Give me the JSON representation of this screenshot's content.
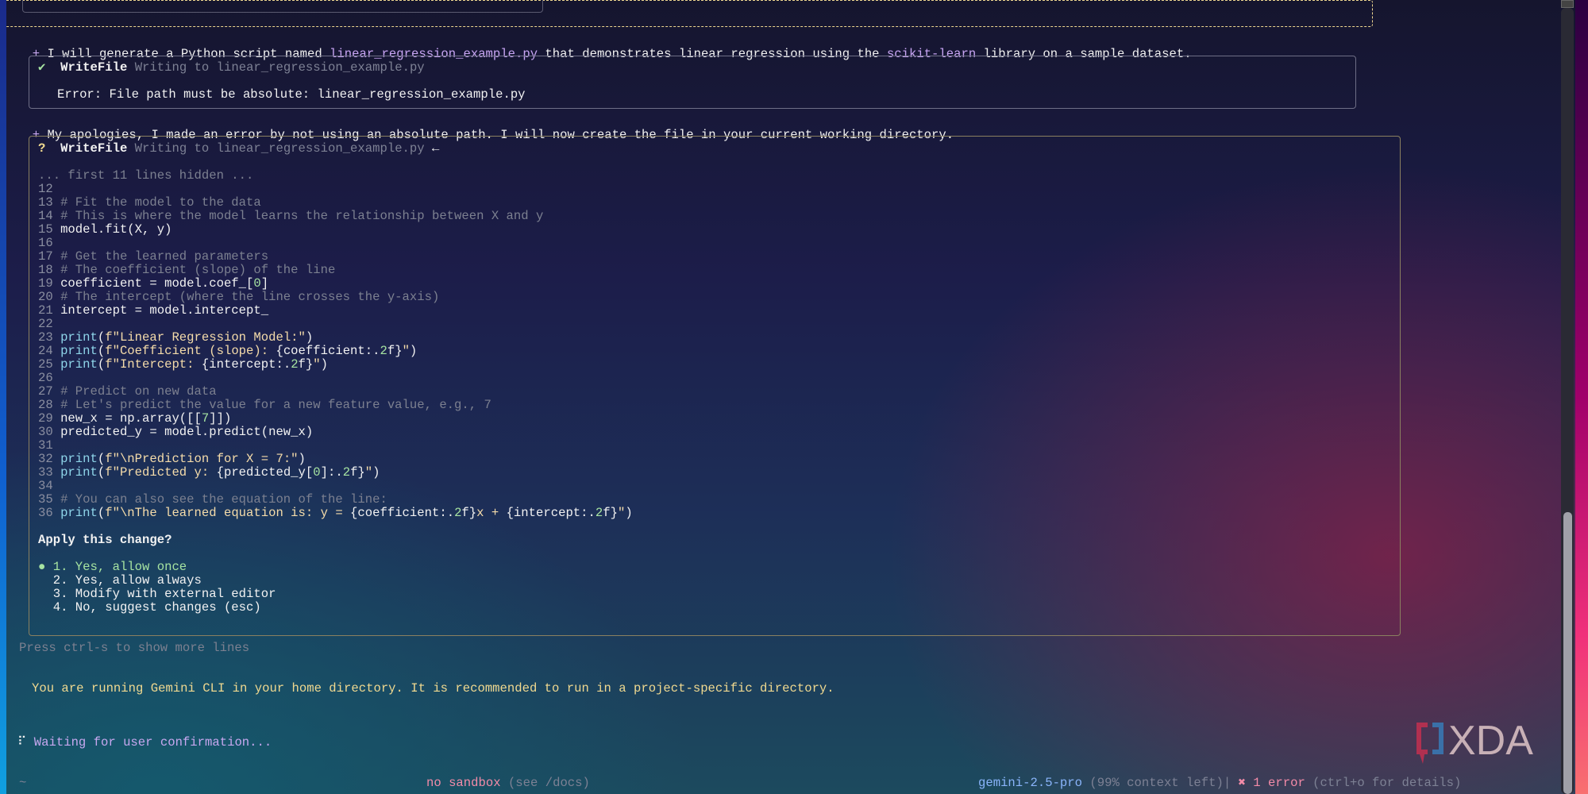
{
  "messages": [
    {
      "bullet": "+",
      "parts": [
        {
          "t": "I will generate a Python script named ",
          "c": "plain"
        },
        {
          "t": "linear_regression_example.py",
          "c": "purple"
        },
        {
          "t": " that demonstrates linear regression using the ",
          "c": "plain"
        },
        {
          "t": "scikit-learn",
          "c": "purple"
        },
        {
          "t": " library on a sample dataset.",
          "c": "plain"
        }
      ]
    },
    {
      "bullet": "+",
      "parts": [
        {
          "t": "My apologies, I made an error by not using an absolute path. I will now create the file in your current working directory.",
          "c": "plain"
        }
      ]
    }
  ],
  "tool1": {
    "status_icon": "✔",
    "name": "WriteFile",
    "desc": "Writing to linear_regression_example.py",
    "error": "Error: File path must be absolute: linear_regression_example.py"
  },
  "tool2": {
    "status_icon": "?",
    "name": "WriteFile",
    "desc": "Writing to linear_regression_example.py",
    "arrow": "←",
    "hidden_note": "... first 11 lines hidden ...",
    "code": [
      {
        "n": "12",
        "s": []
      },
      {
        "n": "13",
        "s": [
          {
            "t": "# Fit the model to the data",
            "c": "comment"
          }
        ]
      },
      {
        "n": "14",
        "s": [
          {
            "t": "# This is where the model learns the relationship between X and y",
            "c": "comment"
          }
        ]
      },
      {
        "n": "15",
        "s": [
          {
            "t": "model.fit(X, y)",
            "c": "plain"
          }
        ]
      },
      {
        "n": "16",
        "s": []
      },
      {
        "n": "17",
        "s": [
          {
            "t": "# Get the learned parameters",
            "c": "comment"
          }
        ]
      },
      {
        "n": "18",
        "s": [
          {
            "t": "# The coefficient (slope) of the line",
            "c": "comment"
          }
        ]
      },
      {
        "n": "19",
        "s": [
          {
            "t": "coefficient = model.coef_[",
            "c": "plain"
          },
          {
            "t": "0",
            "c": "num"
          },
          {
            "t": "]",
            "c": "plain"
          }
        ]
      },
      {
        "n": "20",
        "s": [
          {
            "t": "# The intercept (where the line crosses the y-axis)",
            "c": "comment"
          }
        ]
      },
      {
        "n": "21",
        "s": [
          {
            "t": "intercept = model.intercept_",
            "c": "plain"
          }
        ]
      },
      {
        "n": "22",
        "s": []
      },
      {
        "n": "23",
        "s": [
          {
            "t": "print",
            "c": "fn"
          },
          {
            "t": "(",
            "c": "plain"
          },
          {
            "t": "f\"Linear Regression Model:\"",
            "c": "str"
          },
          {
            "t": ")",
            "c": "plain"
          }
        ]
      },
      {
        "n": "24",
        "s": [
          {
            "t": "print",
            "c": "fn"
          },
          {
            "t": "(",
            "c": "plain"
          },
          {
            "t": "f\"Coefficient (slope): ",
            "c": "str"
          },
          {
            "t": "{coefficient:.",
            "c": "plain"
          },
          {
            "t": "2",
            "c": "num"
          },
          {
            "t": "f}",
            "c": "plain"
          },
          {
            "t": "\"",
            "c": "str"
          },
          {
            "t": ")",
            "c": "plain"
          }
        ]
      },
      {
        "n": "25",
        "s": [
          {
            "t": "print",
            "c": "fn"
          },
          {
            "t": "(",
            "c": "plain"
          },
          {
            "t": "f\"Intercept: ",
            "c": "str"
          },
          {
            "t": "{intercept:.",
            "c": "plain"
          },
          {
            "t": "2",
            "c": "num"
          },
          {
            "t": "f}",
            "c": "plain"
          },
          {
            "t": "\"",
            "c": "str"
          },
          {
            "t": ")",
            "c": "plain"
          }
        ]
      },
      {
        "n": "26",
        "s": []
      },
      {
        "n": "27",
        "s": [
          {
            "t": "# Predict on new data",
            "c": "comment"
          }
        ]
      },
      {
        "n": "28",
        "s": [
          {
            "t": "# Let's predict the value for a new feature value, e.g., 7",
            "c": "comment"
          }
        ]
      },
      {
        "n": "29",
        "s": [
          {
            "t": "new_x = np.array([[",
            "c": "plain"
          },
          {
            "t": "7",
            "c": "num"
          },
          {
            "t": "]])",
            "c": "plain"
          }
        ]
      },
      {
        "n": "30",
        "s": [
          {
            "t": "predicted_y = model.predict(new_x)",
            "c": "plain"
          }
        ]
      },
      {
        "n": "31",
        "s": []
      },
      {
        "n": "32",
        "s": [
          {
            "t": "print",
            "c": "fn"
          },
          {
            "t": "(",
            "c": "plain"
          },
          {
            "t": "f\"\\nPrediction for X = 7:\"",
            "c": "str"
          },
          {
            "t": ")",
            "c": "plain"
          }
        ]
      },
      {
        "n": "33",
        "s": [
          {
            "t": "print",
            "c": "fn"
          },
          {
            "t": "(",
            "c": "plain"
          },
          {
            "t": "f\"Predicted y: ",
            "c": "str"
          },
          {
            "t": "{predicted_y[",
            "c": "plain"
          },
          {
            "t": "0",
            "c": "num"
          },
          {
            "t": "]:.",
            "c": "plain"
          },
          {
            "t": "2",
            "c": "num"
          },
          {
            "t": "f}",
            "c": "plain"
          },
          {
            "t": "\"",
            "c": "str"
          },
          {
            "t": ")",
            "c": "plain"
          }
        ]
      },
      {
        "n": "34",
        "s": []
      },
      {
        "n": "35",
        "s": [
          {
            "t": "# You can also see the equation of the line:",
            "c": "comment"
          }
        ]
      },
      {
        "n": "36",
        "s": [
          {
            "t": "print",
            "c": "fn"
          },
          {
            "t": "(",
            "c": "plain"
          },
          {
            "t": "f\"\\nThe learned equation is: y = ",
            "c": "str"
          },
          {
            "t": "{coefficient:.",
            "c": "plain"
          },
          {
            "t": "2",
            "c": "num"
          },
          {
            "t": "f}",
            "c": "plain"
          },
          {
            "t": "x + ",
            "c": "str"
          },
          {
            "t": "{intercept:.",
            "c": "plain"
          },
          {
            "t": "2",
            "c": "num"
          },
          {
            "t": "f}",
            "c": "plain"
          },
          {
            "t": "\"",
            "c": "str"
          },
          {
            "t": ")",
            "c": "plain"
          }
        ]
      }
    ],
    "question": "Apply this change?",
    "selected_marker": "●",
    "options": [
      "1. Yes, allow once",
      "2. Yes, allow always",
      "3. Modify with external editor",
      "4. No, suggest changes (esc)"
    ]
  },
  "more_lines_hint": "Press ctrl-s to show more lines",
  "warning": "You are running Gemini CLI in your home directory. It is recommended to run in a project-specific directory.",
  "status": {
    "spinner": "⠏",
    "text": "Waiting for user confirmation..."
  },
  "footer": {
    "cwd": "~",
    "sandbox": "no sandbox",
    "sandbox_hint": "(see /docs)",
    "model": "gemini-2.5-pro",
    "context": "(99% context left)",
    "sep": "|",
    "error_icon": "✖",
    "errors": "1 error",
    "errors_hint": "(ctrl+o for details)"
  },
  "watermark": "XDA"
}
